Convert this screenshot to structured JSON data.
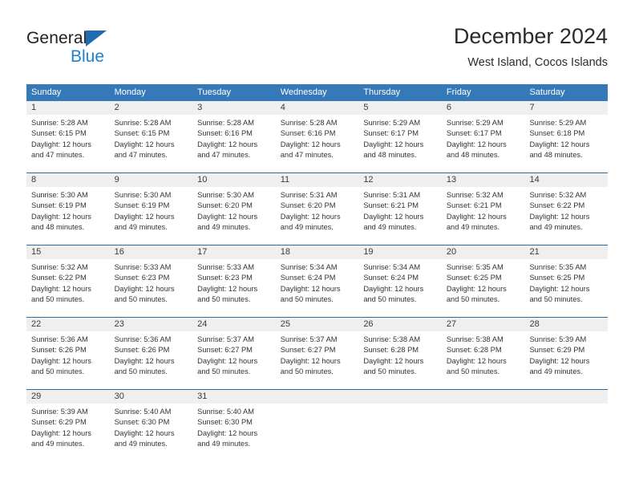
{
  "logo": {
    "word1": "General",
    "word2": "Blue",
    "triangle_color": "#1f6cb0",
    "word2_color": "#1f7fd0"
  },
  "header": {
    "title": "December 2024",
    "subtitle": "West Island, Cocos Islands"
  },
  "theme": {
    "header_bg": "#3579b8",
    "header_text": "#ffffff",
    "daynum_bg": "#efefef",
    "week_divider": "#2e6da4",
    "body_text": "#333333"
  },
  "weekday_headers": [
    "Sunday",
    "Monday",
    "Tuesday",
    "Wednesday",
    "Thursday",
    "Friday",
    "Saturday"
  ],
  "weeks": [
    [
      {
        "day": "1",
        "sunrise": "Sunrise: 5:28 AM",
        "sunset": "Sunset: 6:15 PM",
        "daylight1": "Daylight: 12 hours",
        "daylight2": "and 47 minutes."
      },
      {
        "day": "2",
        "sunrise": "Sunrise: 5:28 AM",
        "sunset": "Sunset: 6:15 PM",
        "daylight1": "Daylight: 12 hours",
        "daylight2": "and 47 minutes."
      },
      {
        "day": "3",
        "sunrise": "Sunrise: 5:28 AM",
        "sunset": "Sunset: 6:16 PM",
        "daylight1": "Daylight: 12 hours",
        "daylight2": "and 47 minutes."
      },
      {
        "day": "4",
        "sunrise": "Sunrise: 5:28 AM",
        "sunset": "Sunset: 6:16 PM",
        "daylight1": "Daylight: 12 hours",
        "daylight2": "and 47 minutes."
      },
      {
        "day": "5",
        "sunrise": "Sunrise: 5:29 AM",
        "sunset": "Sunset: 6:17 PM",
        "daylight1": "Daylight: 12 hours",
        "daylight2": "and 48 minutes."
      },
      {
        "day": "6",
        "sunrise": "Sunrise: 5:29 AM",
        "sunset": "Sunset: 6:17 PM",
        "daylight1": "Daylight: 12 hours",
        "daylight2": "and 48 minutes."
      },
      {
        "day": "7",
        "sunrise": "Sunrise: 5:29 AM",
        "sunset": "Sunset: 6:18 PM",
        "daylight1": "Daylight: 12 hours",
        "daylight2": "and 48 minutes."
      }
    ],
    [
      {
        "day": "8",
        "sunrise": "Sunrise: 5:30 AM",
        "sunset": "Sunset: 6:19 PM",
        "daylight1": "Daylight: 12 hours",
        "daylight2": "and 48 minutes."
      },
      {
        "day": "9",
        "sunrise": "Sunrise: 5:30 AM",
        "sunset": "Sunset: 6:19 PM",
        "daylight1": "Daylight: 12 hours",
        "daylight2": "and 49 minutes."
      },
      {
        "day": "10",
        "sunrise": "Sunrise: 5:30 AM",
        "sunset": "Sunset: 6:20 PM",
        "daylight1": "Daylight: 12 hours",
        "daylight2": "and 49 minutes."
      },
      {
        "day": "11",
        "sunrise": "Sunrise: 5:31 AM",
        "sunset": "Sunset: 6:20 PM",
        "daylight1": "Daylight: 12 hours",
        "daylight2": "and 49 minutes."
      },
      {
        "day": "12",
        "sunrise": "Sunrise: 5:31 AM",
        "sunset": "Sunset: 6:21 PM",
        "daylight1": "Daylight: 12 hours",
        "daylight2": "and 49 minutes."
      },
      {
        "day": "13",
        "sunrise": "Sunrise: 5:32 AM",
        "sunset": "Sunset: 6:21 PM",
        "daylight1": "Daylight: 12 hours",
        "daylight2": "and 49 minutes."
      },
      {
        "day": "14",
        "sunrise": "Sunrise: 5:32 AM",
        "sunset": "Sunset: 6:22 PM",
        "daylight1": "Daylight: 12 hours",
        "daylight2": "and 49 minutes."
      }
    ],
    [
      {
        "day": "15",
        "sunrise": "Sunrise: 5:32 AM",
        "sunset": "Sunset: 6:22 PM",
        "daylight1": "Daylight: 12 hours",
        "daylight2": "and 50 minutes."
      },
      {
        "day": "16",
        "sunrise": "Sunrise: 5:33 AM",
        "sunset": "Sunset: 6:23 PM",
        "daylight1": "Daylight: 12 hours",
        "daylight2": "and 50 minutes."
      },
      {
        "day": "17",
        "sunrise": "Sunrise: 5:33 AM",
        "sunset": "Sunset: 6:23 PM",
        "daylight1": "Daylight: 12 hours",
        "daylight2": "and 50 minutes."
      },
      {
        "day": "18",
        "sunrise": "Sunrise: 5:34 AM",
        "sunset": "Sunset: 6:24 PM",
        "daylight1": "Daylight: 12 hours",
        "daylight2": "and 50 minutes."
      },
      {
        "day": "19",
        "sunrise": "Sunrise: 5:34 AM",
        "sunset": "Sunset: 6:24 PM",
        "daylight1": "Daylight: 12 hours",
        "daylight2": "and 50 minutes."
      },
      {
        "day": "20",
        "sunrise": "Sunrise: 5:35 AM",
        "sunset": "Sunset: 6:25 PM",
        "daylight1": "Daylight: 12 hours",
        "daylight2": "and 50 minutes."
      },
      {
        "day": "21",
        "sunrise": "Sunrise: 5:35 AM",
        "sunset": "Sunset: 6:25 PM",
        "daylight1": "Daylight: 12 hours",
        "daylight2": "and 50 minutes."
      }
    ],
    [
      {
        "day": "22",
        "sunrise": "Sunrise: 5:36 AM",
        "sunset": "Sunset: 6:26 PM",
        "daylight1": "Daylight: 12 hours",
        "daylight2": "and 50 minutes."
      },
      {
        "day": "23",
        "sunrise": "Sunrise: 5:36 AM",
        "sunset": "Sunset: 6:26 PM",
        "daylight1": "Daylight: 12 hours",
        "daylight2": "and 50 minutes."
      },
      {
        "day": "24",
        "sunrise": "Sunrise: 5:37 AM",
        "sunset": "Sunset: 6:27 PM",
        "daylight1": "Daylight: 12 hours",
        "daylight2": "and 50 minutes."
      },
      {
        "day": "25",
        "sunrise": "Sunrise: 5:37 AM",
        "sunset": "Sunset: 6:27 PM",
        "daylight1": "Daylight: 12 hours",
        "daylight2": "and 50 minutes."
      },
      {
        "day": "26",
        "sunrise": "Sunrise: 5:38 AM",
        "sunset": "Sunset: 6:28 PM",
        "daylight1": "Daylight: 12 hours",
        "daylight2": "and 50 minutes."
      },
      {
        "day": "27",
        "sunrise": "Sunrise: 5:38 AM",
        "sunset": "Sunset: 6:28 PM",
        "daylight1": "Daylight: 12 hours",
        "daylight2": "and 50 minutes."
      },
      {
        "day": "28",
        "sunrise": "Sunrise: 5:39 AM",
        "sunset": "Sunset: 6:29 PM",
        "daylight1": "Daylight: 12 hours",
        "daylight2": "and 49 minutes."
      }
    ],
    [
      {
        "day": "29",
        "sunrise": "Sunrise: 5:39 AM",
        "sunset": "Sunset: 6:29 PM",
        "daylight1": "Daylight: 12 hours",
        "daylight2": "and 49 minutes."
      },
      {
        "day": "30",
        "sunrise": "Sunrise: 5:40 AM",
        "sunset": "Sunset: 6:30 PM",
        "daylight1": "Daylight: 12 hours",
        "daylight2": "and 49 minutes."
      },
      {
        "day": "31",
        "sunrise": "Sunrise: 5:40 AM",
        "sunset": "Sunset: 6:30 PM",
        "daylight1": "Daylight: 12 hours",
        "daylight2": "and 49 minutes."
      },
      {
        "day": "",
        "sunrise": "",
        "sunset": "",
        "daylight1": "",
        "daylight2": ""
      },
      {
        "day": "",
        "sunrise": "",
        "sunset": "",
        "daylight1": "",
        "daylight2": ""
      },
      {
        "day": "",
        "sunrise": "",
        "sunset": "",
        "daylight1": "",
        "daylight2": ""
      },
      {
        "day": "",
        "sunrise": "",
        "sunset": "",
        "daylight1": "",
        "daylight2": ""
      }
    ]
  ]
}
